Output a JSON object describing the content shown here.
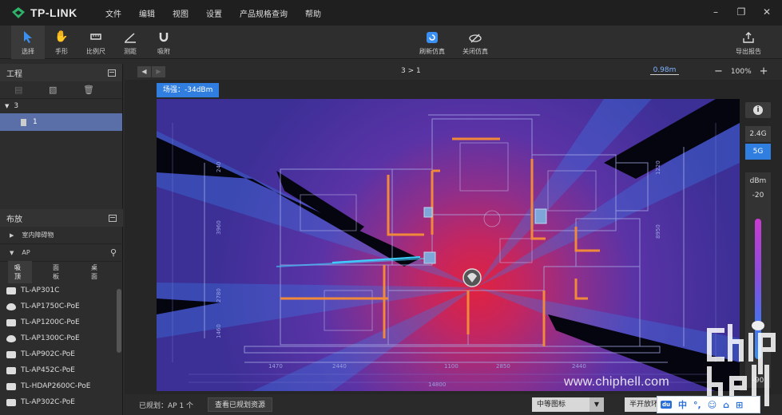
{
  "app": {
    "logo": "TP-LINK"
  },
  "menu": [
    "文件",
    "编辑",
    "视图",
    "设置",
    "产品规格查询",
    "帮助"
  ],
  "window_controls": [
    "minimize",
    "restore",
    "close"
  ],
  "toolbar": {
    "tools": [
      {
        "label": "选择",
        "icon": "cursor-icon",
        "active": true
      },
      {
        "label": "手形",
        "icon": "hand-icon"
      },
      {
        "label": "比例尺",
        "icon": "ruler-icon"
      },
      {
        "label": "测距",
        "icon": "measure-icon"
      },
      {
        "label": "吸附",
        "icon": "magnet-icon"
      }
    ],
    "refresh_label": "刷新仿真",
    "close_sim_label": "关闭仿真",
    "export_label": "导出报告"
  },
  "project": {
    "title": "工程",
    "root": "3",
    "child": "1"
  },
  "placement": {
    "title": "布放",
    "obstacle_category": "室内障碍物",
    "ap_category": "AP",
    "subtabs": [
      "吸顶",
      "面板",
      "桌面"
    ],
    "ap_items": [
      "TL-AP301C",
      "TL-AP1750C-PoE",
      "TL-AP1200C-PoE",
      "TL-AP1300C-PoE",
      "TL-AP902C-PoE",
      "TL-AP452C-PoE",
      "TL-HDAP2600C-PoE",
      "TL-AP302C-PoE"
    ]
  },
  "view": {
    "breadcrumb": "3 > 1",
    "scale": "0.98m",
    "zoom": "100%",
    "field_strength": "场强：-34dBm",
    "band_24": "2.4G",
    "band_5": "5G",
    "legend_unit": "dBm",
    "legend_max": "-20",
    "legend_min": "-90",
    "dimensions_bottom": [
      "1470",
      "2440",
      "1100",
      "2850",
      "2440",
      "14800"
    ],
    "dimensions_left": [
      "240",
      "3960",
      "2780",
      "1460"
    ],
    "dimensions_right": [
      "8950",
      "1220"
    ]
  },
  "status": {
    "planned": "已规划：AP 1 个",
    "view_planned": "查看已规划资源",
    "icon_size": "中等图标",
    "half_open": "半开放环"
  },
  "ime": {
    "badge": "du",
    "items": [
      "中",
      "°,",
      "☺",
      "⌂",
      "⊞"
    ]
  },
  "watermark": {
    "url": "www.chiphell.com"
  },
  "colors": {
    "accent": "#2f7ee0",
    "ap_active": "#5a6fa8",
    "heat_hot": "#e0223f",
    "heat_cold": "#3a2a8a"
  }
}
